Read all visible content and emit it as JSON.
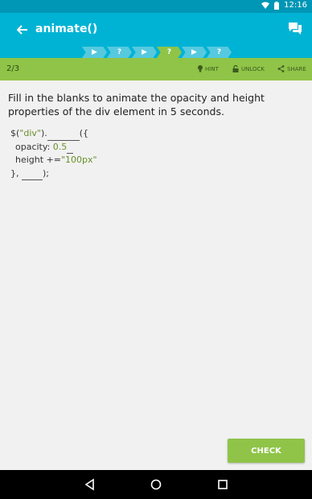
{
  "status": {
    "time": "12:16"
  },
  "appbar": {
    "title": "animate()"
  },
  "stepper": {
    "steps": [
      {
        "label": "▶",
        "active": false
      },
      {
        "label": "?",
        "active": false
      },
      {
        "label": "▶",
        "active": false
      },
      {
        "label": "?",
        "active": true
      },
      {
        "label": "▶",
        "active": false
      },
      {
        "label": "?",
        "active": false
      }
    ]
  },
  "toolbar": {
    "progress": "2/3",
    "hint": "HINT",
    "unlock": "UNLOCK",
    "share": "SHARE"
  },
  "question": {
    "text": "Fill in the blanks to animate the opacity and height properties of the div element in 5 seconds."
  },
  "code": {
    "l1_a": "$(",
    "l1_str": "\"div\"",
    "l1_b": ").",
    "l1_c": "({",
    "l2_a": "opacity: ",
    "l2_num": "0.5",
    "l3_a": "height +=",
    "l3_str": "\"100px\"",
    "l4_a": "}, ",
    "l4_b": ");"
  },
  "check_label": "CHECK"
}
